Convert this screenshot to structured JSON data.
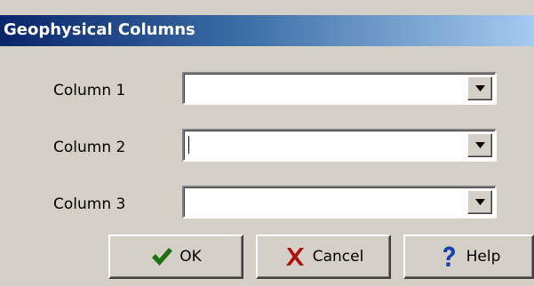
{
  "dialog": {
    "title": "Geophysical Columns"
  },
  "fields": [
    {
      "label": "Column 1",
      "value": ""
    },
    {
      "label": "Column 2",
      "value": ""
    },
    {
      "label": "Column 3",
      "value": ""
    }
  ],
  "buttons": {
    "ok": "OK",
    "cancel": "Cancel",
    "help": "Help"
  },
  "icons": {
    "ok": "checkmark-icon",
    "cancel": "x-icon",
    "help": "question-mark-icon",
    "dropdown": "dropdown-arrow-icon"
  },
  "colors": {
    "dialog_bg": "#d4d0c8",
    "title_gradient_start": "#0a246a",
    "title_gradient_end": "#a6caf0",
    "ok_icon": "#1f6f12",
    "cancel_icon": "#b01010",
    "help_icon": "#1c3fae"
  }
}
